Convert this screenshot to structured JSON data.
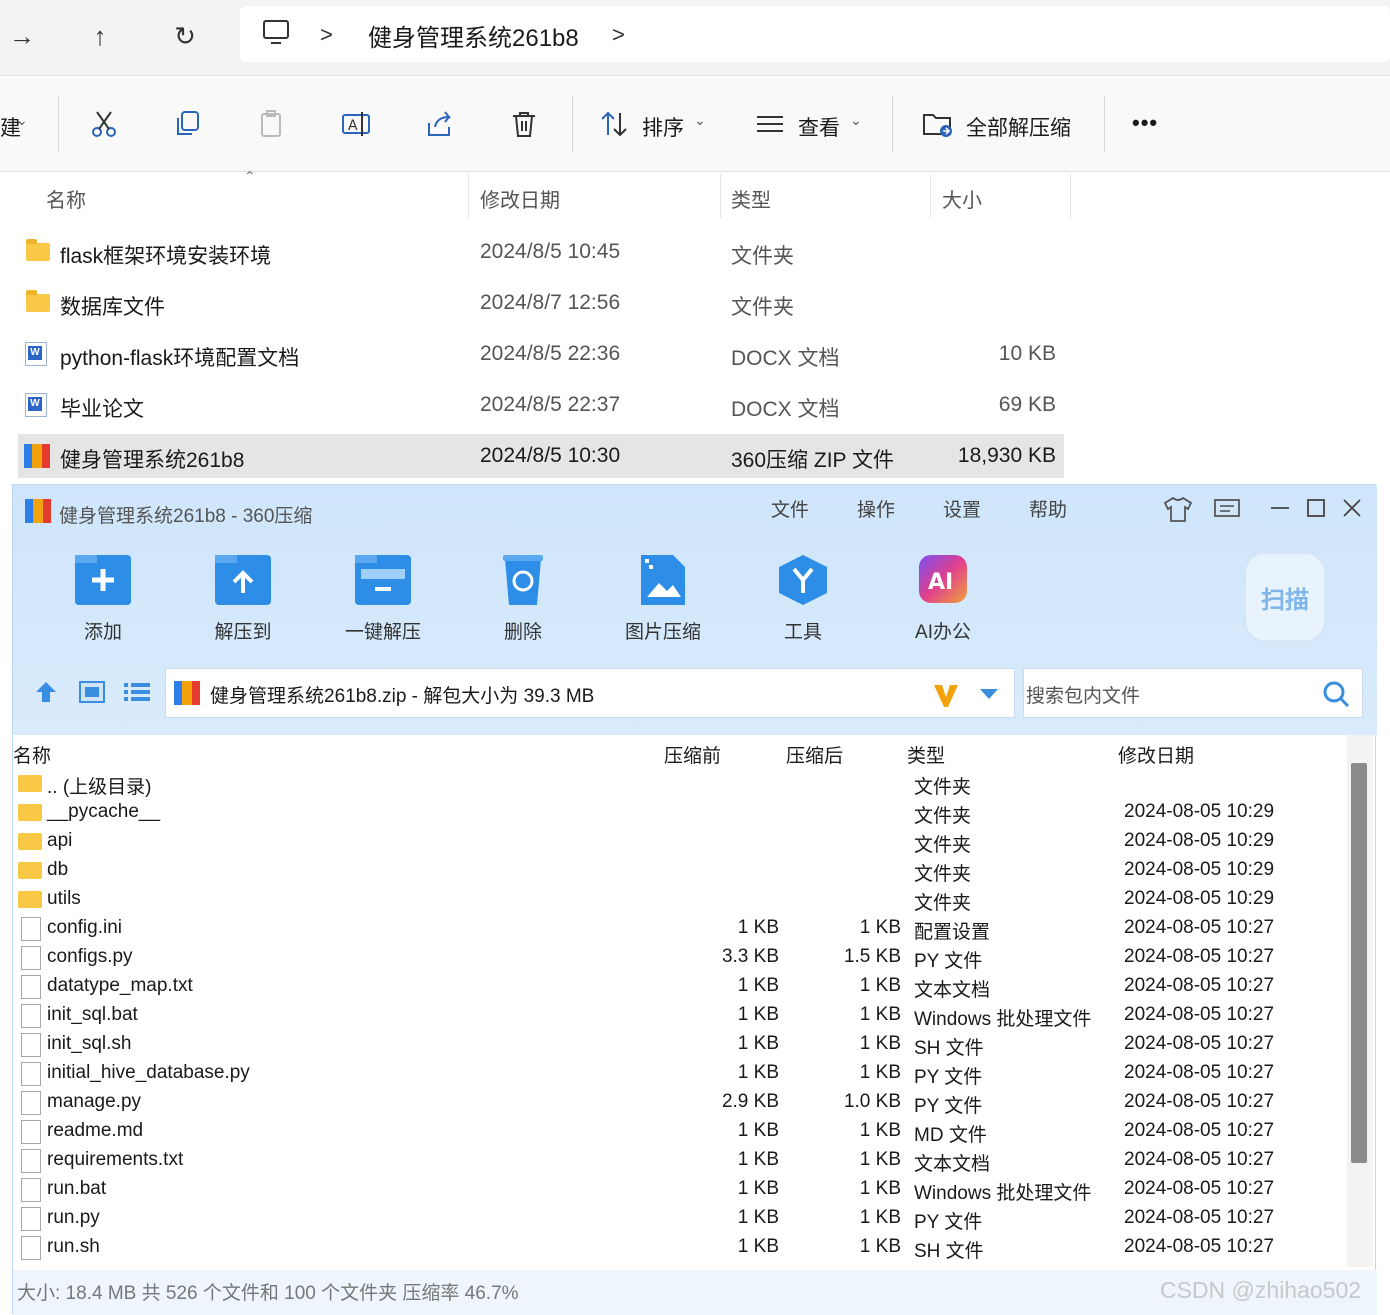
{
  "explorer": {
    "breadcrumb": {
      "separator": ">",
      "folder": "健身管理系统261b8"
    },
    "ribbon": {
      "new_partial": "建",
      "sort_label": "排序",
      "view_label": "查看",
      "extract_all_label": "全部解压缩",
      "more_label": "•••"
    },
    "columns": {
      "name": "名称",
      "date": "修改日期",
      "type": "类型",
      "size": "大小"
    },
    "files": [
      {
        "name": "flask框架环境安装环境",
        "date": "2024/8/5 10:45",
        "type": "文件夹",
        "size": "",
        "icon": "folder-icon"
      },
      {
        "name": "数据库文件",
        "date": "2024/8/7 12:56",
        "type": "文件夹",
        "size": "",
        "icon": "folder-icon"
      },
      {
        "name": "python-flask环境配置文档",
        "date": "2024/8/5 22:36",
        "type": "DOCX 文档",
        "size": "10 KB",
        "icon": "word-doc-icon"
      },
      {
        "name": "毕业论文",
        "date": "2024/8/5 22:37",
        "type": "DOCX 文档",
        "size": "69 KB",
        "icon": "word-doc-icon"
      },
      {
        "name": "健身管理系统261b8",
        "date": "2024/8/5 10:30",
        "type": "360压缩 ZIP 文件",
        "size": "18,930 KB",
        "icon": "zip-archive-icon"
      }
    ]
  },
  "zip": {
    "title": "健身管理系统261b8 - 360压缩",
    "menu": [
      "文件",
      "操作",
      "设置",
      "帮助"
    ],
    "toolbar": [
      {
        "label": "添加",
        "icon": "add-folder-icon",
        "color": "#2e8de6"
      },
      {
        "label": "解压到",
        "icon": "extract-to-icon",
        "color": "#2e8de6"
      },
      {
        "label": "一键解压",
        "icon": "one-click-extract-icon",
        "color": "#2e8de6"
      },
      {
        "label": "删除",
        "icon": "recycle-delete-icon",
        "color": "#2e8de6"
      },
      {
        "label": "图片压缩",
        "icon": "image-compress-icon",
        "color": "#2e8de6"
      },
      {
        "label": "工具",
        "icon": "tools-icon",
        "color": "#2e8de6"
      },
      {
        "label": "AI办公",
        "icon": "ai-office-icon",
        "color": "#e0408e"
      }
    ],
    "scan_label": "扫描",
    "path": "健身管理系统261b8.zip - 解包大小为 39.3 MB",
    "search_placeholder": "搜索包内文件",
    "columns": {
      "name": "名称",
      "before": "压缩前",
      "after": "压缩后",
      "type": "类型",
      "date": "修改日期"
    },
    "rows": [
      {
        "name": ".. (上级目录)",
        "before": "",
        "after": "",
        "type": "文件夹",
        "date": "",
        "kind": "folder"
      },
      {
        "name": "__pycache__",
        "before": "",
        "after": "",
        "type": "文件夹",
        "date": "2024-08-05 10:29",
        "kind": "folder"
      },
      {
        "name": "api",
        "before": "",
        "after": "",
        "type": "文件夹",
        "date": "2024-08-05 10:29",
        "kind": "folder"
      },
      {
        "name": "db",
        "before": "",
        "after": "",
        "type": "文件夹",
        "date": "2024-08-05 10:29",
        "kind": "folder"
      },
      {
        "name": "utils",
        "before": "",
        "after": "",
        "type": "文件夹",
        "date": "2024-08-05 10:29",
        "kind": "folder"
      },
      {
        "name": "config.ini",
        "before": "1 KB",
        "after": "1 KB",
        "type": "配置设置",
        "date": "2024-08-05 10:27",
        "kind": "file"
      },
      {
        "name": "configs.py",
        "before": "3.3 KB",
        "after": "1.5 KB",
        "type": "PY 文件",
        "date": "2024-08-05 10:27",
        "kind": "file"
      },
      {
        "name": "datatype_map.txt",
        "before": "1 KB",
        "after": "1 KB",
        "type": "文本文档",
        "date": "2024-08-05 10:27",
        "kind": "file"
      },
      {
        "name": "init_sql.bat",
        "before": "1 KB",
        "after": "1 KB",
        "type": "Windows 批处理文件",
        "date": "2024-08-05 10:27",
        "kind": "file"
      },
      {
        "name": "init_sql.sh",
        "before": "1 KB",
        "after": "1 KB",
        "type": "SH 文件",
        "date": "2024-08-05 10:27",
        "kind": "file"
      },
      {
        "name": "initial_hive_database.py",
        "before": "1 KB",
        "after": "1 KB",
        "type": "PY 文件",
        "date": "2024-08-05 10:27",
        "kind": "file"
      },
      {
        "name": "manage.py",
        "before": "2.9 KB",
        "after": "1.0 KB",
        "type": "PY 文件",
        "date": "2024-08-05 10:27",
        "kind": "file"
      },
      {
        "name": "readme.md",
        "before": "1 KB",
        "after": "1 KB",
        "type": "MD 文件",
        "date": "2024-08-05 10:27",
        "kind": "file"
      },
      {
        "name": "requirements.txt",
        "before": "1 KB",
        "after": "1 KB",
        "type": "文本文档",
        "date": "2024-08-05 10:27",
        "kind": "file"
      },
      {
        "name": "run.bat",
        "before": "1 KB",
        "after": "1 KB",
        "type": "Windows 批处理文件",
        "date": "2024-08-05 10:27",
        "kind": "file"
      },
      {
        "name": "run.py",
        "before": "1 KB",
        "after": "1 KB",
        "type": "PY 文件",
        "date": "2024-08-05 10:27",
        "kind": "file"
      },
      {
        "name": "run.sh",
        "before": "1 KB",
        "after": "1 KB",
        "type": "SH 文件",
        "date": "2024-08-05 10:27",
        "kind": "file"
      }
    ],
    "status": "大小: 18.4 MB 共 526 个文件和 100 个文件夹 压缩率 46.7%"
  },
  "watermark": "CSDN @zhihao502"
}
